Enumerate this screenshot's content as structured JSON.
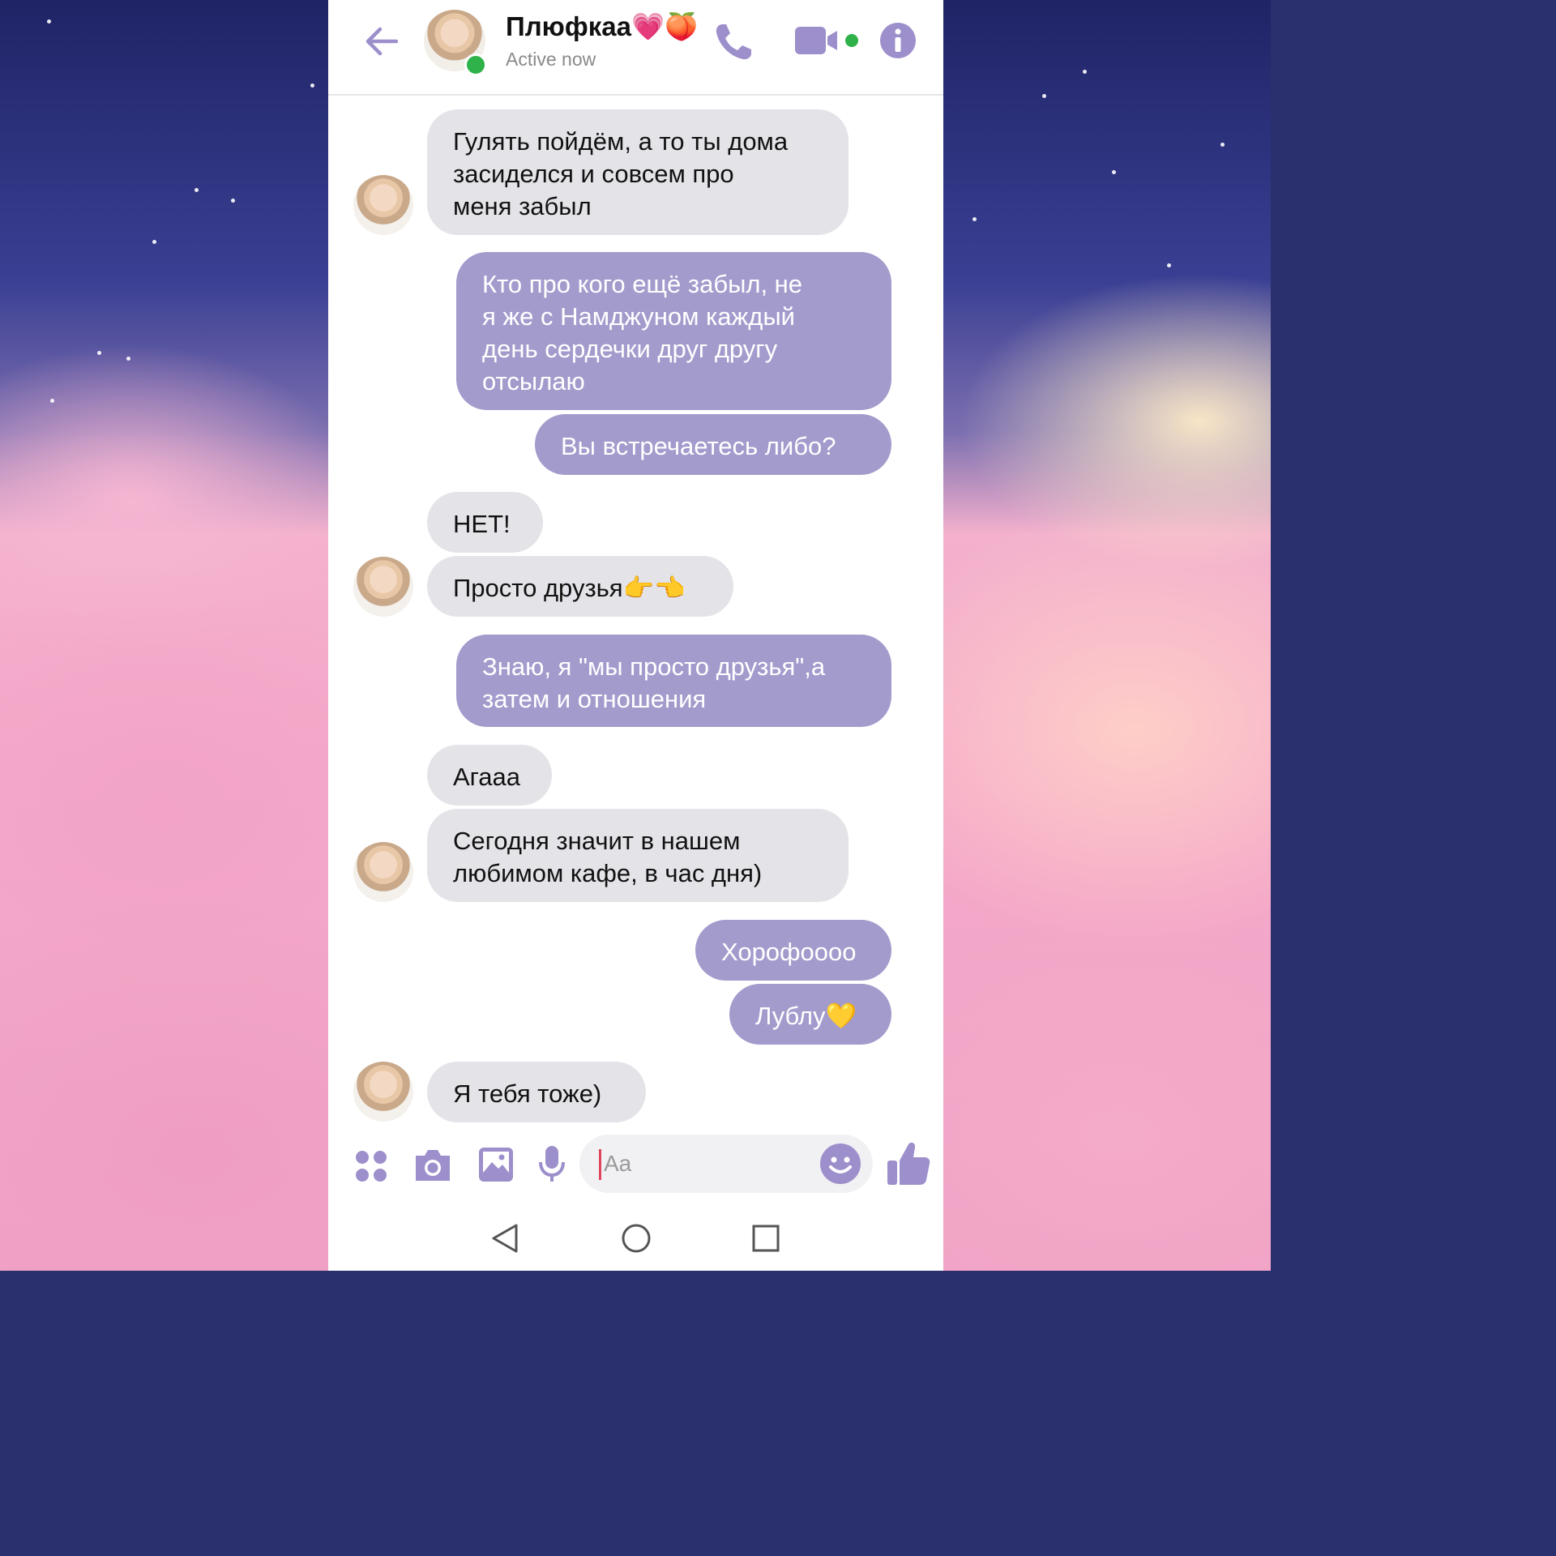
{
  "header": {
    "contact_name": "Плюфкаа💗🍑",
    "status": "Active now"
  },
  "messages": [
    {
      "from": "them",
      "text": "Гулять пойдём, а то ты дома\nзасиделся и совсем про\nменя забыл"
    },
    {
      "from": "me",
      "text": "Кто про кого ещё забыл, не\nя же с Намджуном каждый\nдень сердечки друг другу\nотсылаю"
    },
    {
      "from": "me",
      "text": "Вы встречаетесь либо?"
    },
    {
      "from": "them",
      "text": "НЕТ!"
    },
    {
      "from": "them",
      "text": "Просто друзья👉👈"
    },
    {
      "from": "me",
      "text": "Знаю, я \"мы просто друзья\",а\nзатем и отношения"
    },
    {
      "from": "them",
      "text": "Агааа"
    },
    {
      "from": "them",
      "text": "Сегодня значит в нашем\nлюбимом кафе, в час дня)"
    },
    {
      "from": "me",
      "text": "Хорофоооо"
    },
    {
      "from": "me",
      "text": "Лублу💛"
    },
    {
      "from": "them",
      "text": "Я тебя тоже)"
    }
  ],
  "composer": {
    "placeholder": "Aa",
    "icons": [
      "apps-icon",
      "camera-icon",
      "gallery-icon",
      "microphone-icon",
      "emoji-icon",
      "thumbs-up-icon"
    ]
  },
  "nav": {
    "icons": [
      "nav-back-icon",
      "nav-home-icon",
      "nav-recents-icon"
    ]
  },
  "colors": {
    "accent": "#9d8fcb",
    "outgoing_bubble": "#a49bcd",
    "incoming_bubble": "#e4e3e8",
    "online": "#2fb24a"
  }
}
